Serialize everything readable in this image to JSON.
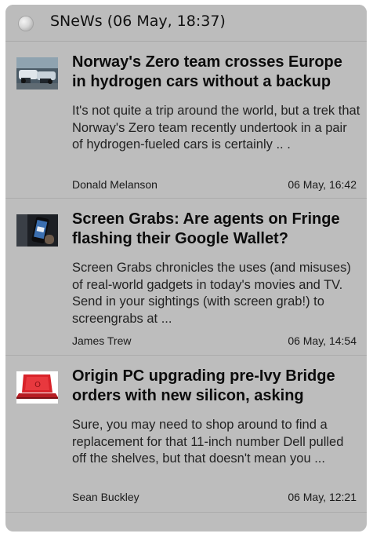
{
  "widget": {
    "title": "SNeWs (06 May, 18:37)",
    "refresh_icon": "refresh-icon"
  },
  "articles": [
    {
      "headline": "Norway's Zero team crosses Europe in hydrogen cars without a backup",
      "summary": "It's not quite a trip around the world, but a trek that Norway's Zero team recently undertook in a pair of hydrogen-fueled cars is certainly .. .",
      "author": "Donald Melanson",
      "time": "06 May, 16:42",
      "thumbnail": "cars-thumbnail"
    },
    {
      "headline": "Screen Grabs: Are agents on Fringe flashing their Google Wallet?",
      "summary": "Screen Grabs chronicles the uses (and misuses) of real-world gadgets in today's movies and TV. Send in your sightings (with screen grab!) to screengrabs at ...",
      "author": "James Trew",
      "time": "06 May, 14:54",
      "thumbnail": "phone-thumbnail"
    },
    {
      "headline": "Origin PC upgrading pre-Ivy Bridge orders with new silicon, asking",
      "summary": "Sure, you may need to shop around to find a replacement for that 11-inch number Dell pulled off the shelves, but that doesn't mean you ...",
      "author": "Sean Buckley",
      "time": "06 May, 12:21",
      "thumbnail": "laptop-thumbnail"
    }
  ]
}
